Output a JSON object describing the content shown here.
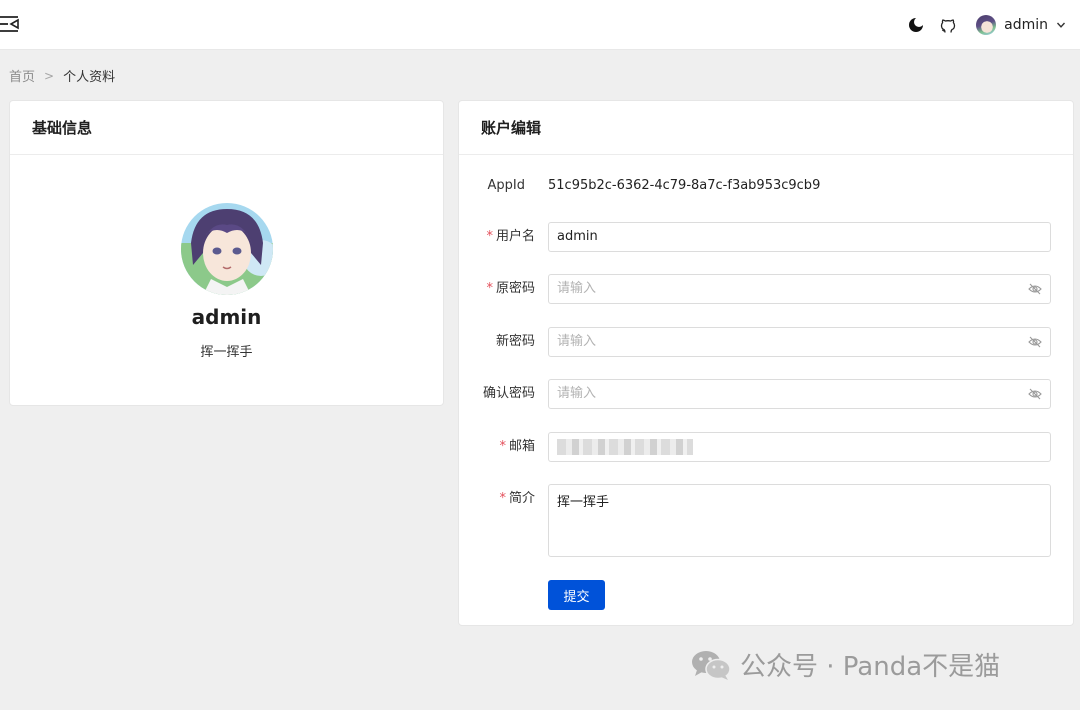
{
  "header": {
    "user_name": "admin",
    "icons": {
      "menu": "menu-fold-icon",
      "theme": "moon-icon",
      "github": "github-icon",
      "dropdown": "chevron-down-icon"
    }
  },
  "breadcrumb": {
    "home": "首页",
    "separator": ">",
    "current": "个人资料"
  },
  "basic_info": {
    "title": "基础信息",
    "name": "admin",
    "bio": "挥一挥手"
  },
  "account_edit": {
    "title": "账户编辑",
    "app_id_label": "AppId",
    "app_id_value": "51c95b2c-6362-4c79-8a7c-f3ab953c9cb9",
    "username_label": "用户名",
    "username_value": "admin",
    "old_password_label": "原密码",
    "old_password_placeholder": "请输入",
    "new_password_label": "新密码",
    "new_password_placeholder": "请输入",
    "confirm_password_label": "确认密码",
    "confirm_password_placeholder": "请输入",
    "email_label": "邮箱",
    "intro_label": "简介",
    "intro_value": "挥一挥手",
    "required_mark": "*",
    "submit_label": "提交"
  },
  "watermark": {
    "text": "公众号 · Panda不是猫"
  },
  "colors": {
    "primary": "#0052d9",
    "required": "#e34d59",
    "background": "#efefef"
  }
}
